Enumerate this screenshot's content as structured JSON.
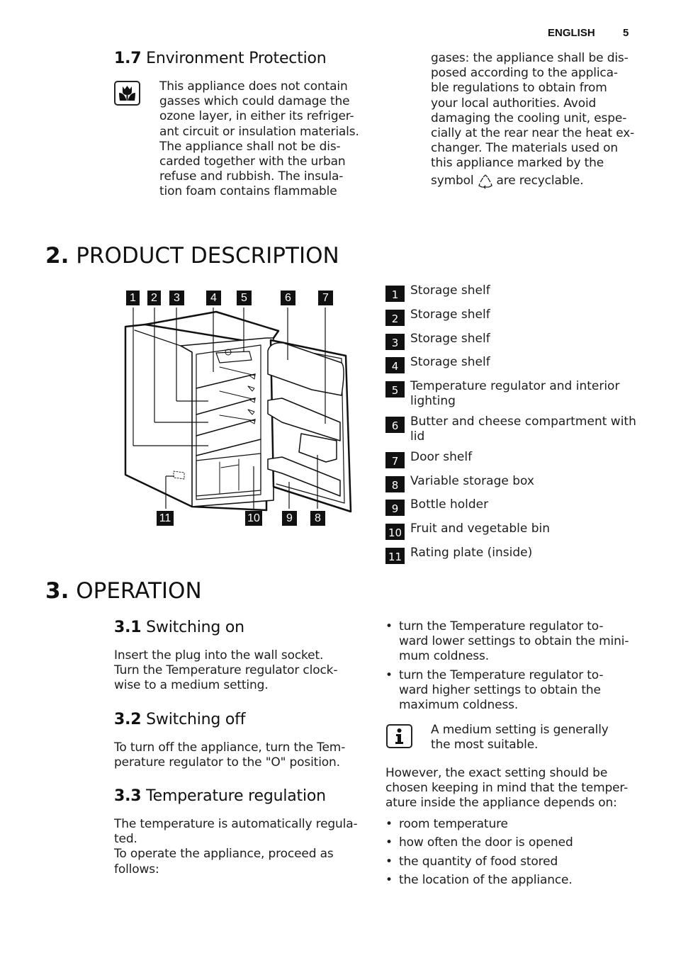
{
  "header": {
    "language": "ENGLISH",
    "page_number": "5"
  },
  "section_1_7": {
    "number": "1.7",
    "title": "Environment Protection",
    "icon": "eco-flower-icon",
    "col1_lines": [
      "This appliance does not contain",
      "gasses which could damage the",
      "ozone layer, in either its refriger-",
      "ant circuit or insulation materials.",
      "The appliance shall not be dis-",
      "carded together with the urban",
      "refuse and rubbish. The insula-",
      "tion foam contains flammable"
    ],
    "col2_lines": [
      "gases: the appliance shall be dis-",
      "posed according to the applica-",
      "ble regulations to obtain from",
      "your local authorities. Avoid",
      "damaging the cooling unit, espe-",
      "cially at the rear near the heat ex-",
      "changer. The materials used on",
      "this appliance marked by the"
    ],
    "col2_last_prefix": "symbol",
    "col2_last_suffix": "are recyclable.",
    "recycle_icon": "recycle-icon"
  },
  "section_2": {
    "number": "2.",
    "title": "PRODUCT DESCRIPTION",
    "diagram_callouts_top": [
      "1",
      "2",
      "3",
      "4",
      "5",
      "6",
      "7"
    ],
    "diagram_callouts_bottom": [
      "11",
      "10",
      "9",
      "8"
    ],
    "legend": [
      {
        "num": "1",
        "label": "Storage shelf"
      },
      {
        "num": "2",
        "label": "Storage shelf"
      },
      {
        "num": "3",
        "label": "Storage shelf"
      },
      {
        "num": "4",
        "label": "Storage shelf"
      },
      {
        "num": "5",
        "label": "Temperature regulator and interior lighting"
      },
      {
        "num": "6",
        "label": "Butter and cheese compartment with lid"
      },
      {
        "num": "7",
        "label": "Door shelf"
      },
      {
        "num": "8",
        "label": "Variable storage box"
      },
      {
        "num": "9",
        "label": "Bottle holder"
      },
      {
        "num": "10",
        "label": "Fruit and vegetable bin"
      },
      {
        "num": "11",
        "label": "Rating plate (inside)"
      }
    ]
  },
  "section_3": {
    "number": "3.",
    "title": "OPERATION",
    "s3_1": {
      "number": "3.1",
      "title": "Switching on",
      "lines": [
        "Insert the plug into the wall socket.",
        "Turn the Temperature regulator clock-",
        "wise to a medium setting."
      ]
    },
    "s3_2": {
      "number": "3.2",
      "title": "Switching off",
      "lines": [
        "To turn off the appliance, turn the Tem-",
        "perature regulator to the \"O\" position."
      ]
    },
    "s3_3": {
      "number": "3.3",
      "title": "Temperature regulation",
      "lines": [
        "The temperature is automatically regula-",
        "ted.",
        "To operate the appliance, proceed as",
        "follows:"
      ]
    },
    "right_bullets": [
      [
        "turn the Temperature regulator to-",
        "ward lower settings to obtain the mini-",
        "mum coldness."
      ],
      [
        "turn the Temperature regulator to-",
        "ward higher settings to obtain the",
        "maximum coldness."
      ]
    ],
    "info_note_lines": [
      "A medium setting is generally",
      "the most suitable."
    ],
    "info_icon": "info-icon",
    "however_lines": [
      "However, the exact setting should be",
      "chosen keeping in mind that the temper-",
      "ature inside the appliance depends on:"
    ],
    "depends_on": [
      "room temperature",
      "how often the door is opened",
      "the quantity of food stored",
      "the location of the appliance."
    ]
  }
}
